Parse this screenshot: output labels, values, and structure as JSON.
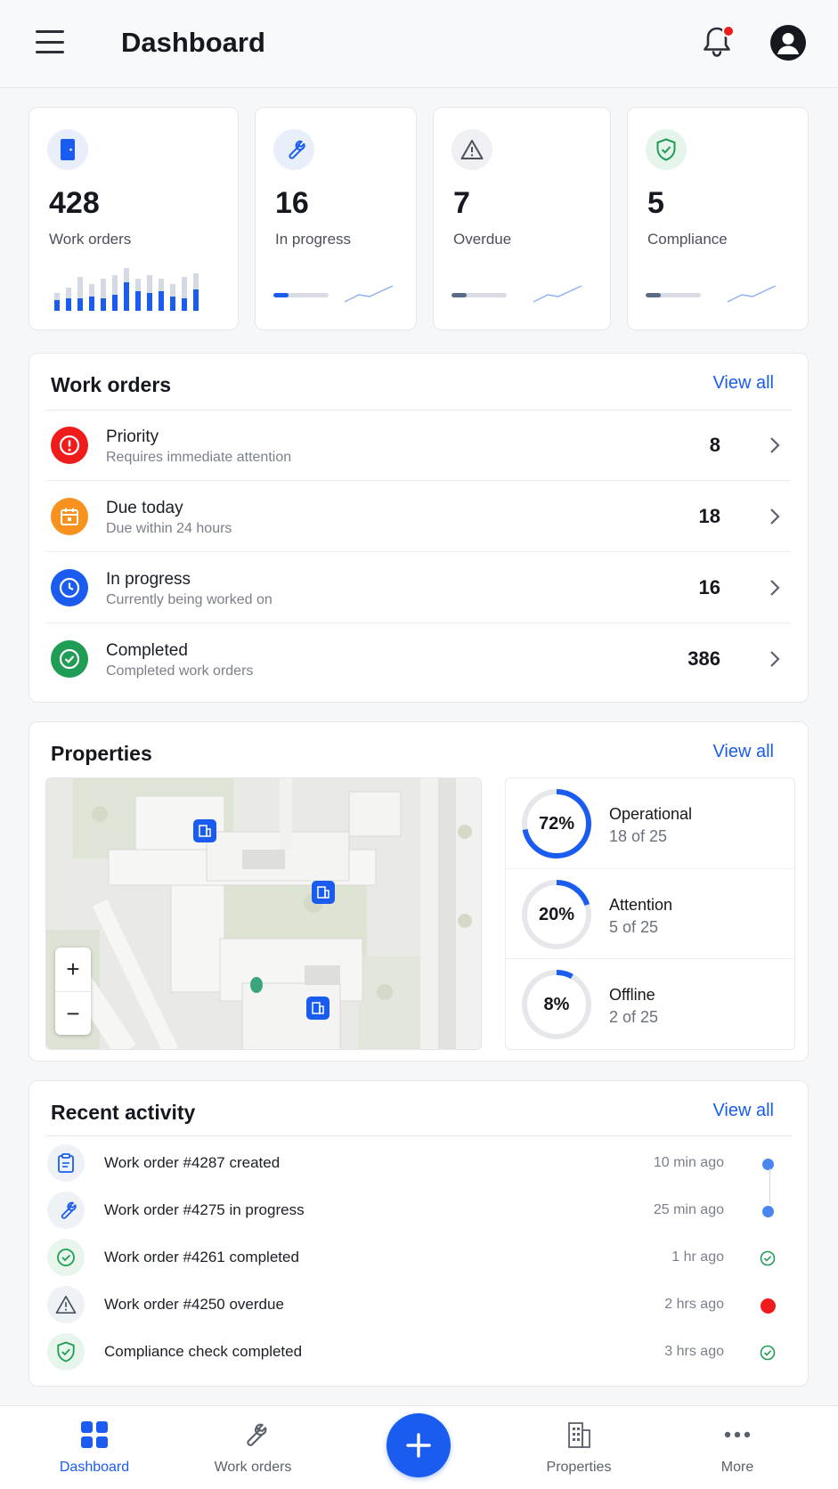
{
  "header": {
    "title": "Dashboard",
    "notification_dot_color": "#f01c1c"
  },
  "stats": [
    {
      "icon": "door-icon",
      "value": "428",
      "label": "Work orders",
      "accent": "#1a5cf0"
    },
    {
      "icon": "wrench-icon",
      "value": "16",
      "label": "In progress",
      "accent": "#1a5cf0"
    },
    {
      "icon": "warning-icon",
      "value": "7",
      "label": "Overdue",
      "accent": "#5b6a85"
    },
    {
      "icon": "shield-check-icon",
      "value": "5",
      "label": "Compliance",
      "accent": "#5b6a85"
    }
  ],
  "work_orders": {
    "title": "Work orders",
    "view_all": "View all",
    "rows": [
      {
        "icon": "alert-circle-icon",
        "color": "#f01c1c",
        "title": "Priority",
        "subtitle": "Requires immediate attention",
        "count": "8"
      },
      {
        "icon": "calendar-icon",
        "color": "#f8921e",
        "title": "Due today",
        "subtitle": "Due within 24 hours",
        "count": "18"
      },
      {
        "icon": "clock-icon",
        "color": "#1a5cf0",
        "title": "In progress",
        "subtitle": "Currently being worked on",
        "count": "16"
      },
      {
        "icon": "check-circle-icon",
        "color": "#1f9d55",
        "title": "Completed",
        "subtitle": "Completed work orders",
        "count": "386"
      }
    ]
  },
  "properties": {
    "title": "Properties",
    "view_all": "View all",
    "zoom_in": "+",
    "zoom_out": "−",
    "statuses": [
      {
        "pct_label": "72%",
        "fraction": 0.72,
        "name": "Operational",
        "sub": "18 of 25"
      },
      {
        "pct_label": "20%",
        "fraction": 0.2,
        "name": "Attention",
        "sub": "5 of 25"
      },
      {
        "pct_label": "8%",
        "fraction": 0.08,
        "name": "Offline",
        "sub": "2 of 25"
      }
    ]
  },
  "activity": {
    "title": "Recent activity",
    "view_all": "View all",
    "items": [
      {
        "icon": "clipboard-icon",
        "text": "Work order #4287 created",
        "time": "10 min ago",
        "status": "blue-dot"
      },
      {
        "icon": "wrench-icon",
        "text": "Work order #4275 in progress",
        "time": "25 min ago",
        "status": "blue-dot"
      },
      {
        "icon": "check-circle-icon",
        "text": "Work order #4261 completed",
        "time": "1 hr ago",
        "status": "green-check"
      },
      {
        "icon": "warning-icon",
        "text": "Work order #4250 overdue",
        "time": "2 hrs ago",
        "status": "red-dot"
      },
      {
        "icon": "shield-check-icon",
        "text": "Compliance check completed",
        "time": "3 hrs ago",
        "status": "green-check"
      }
    ]
  },
  "nav": {
    "items": [
      {
        "icon": "grid-icon",
        "label": "Dashboard",
        "active": true
      },
      {
        "icon": "wrench-icon",
        "label": "Work orders",
        "active": false
      },
      {
        "icon": "building-icon",
        "label": "Properties",
        "active": false
      },
      {
        "icon": "more-icon",
        "label": "More",
        "active": false
      }
    ],
    "fab_icon": "plus-icon"
  },
  "colors": {
    "primary": "#1a5cf0",
    "danger": "#f01c1c",
    "warning": "#f8921e",
    "success": "#1f9d55"
  }
}
